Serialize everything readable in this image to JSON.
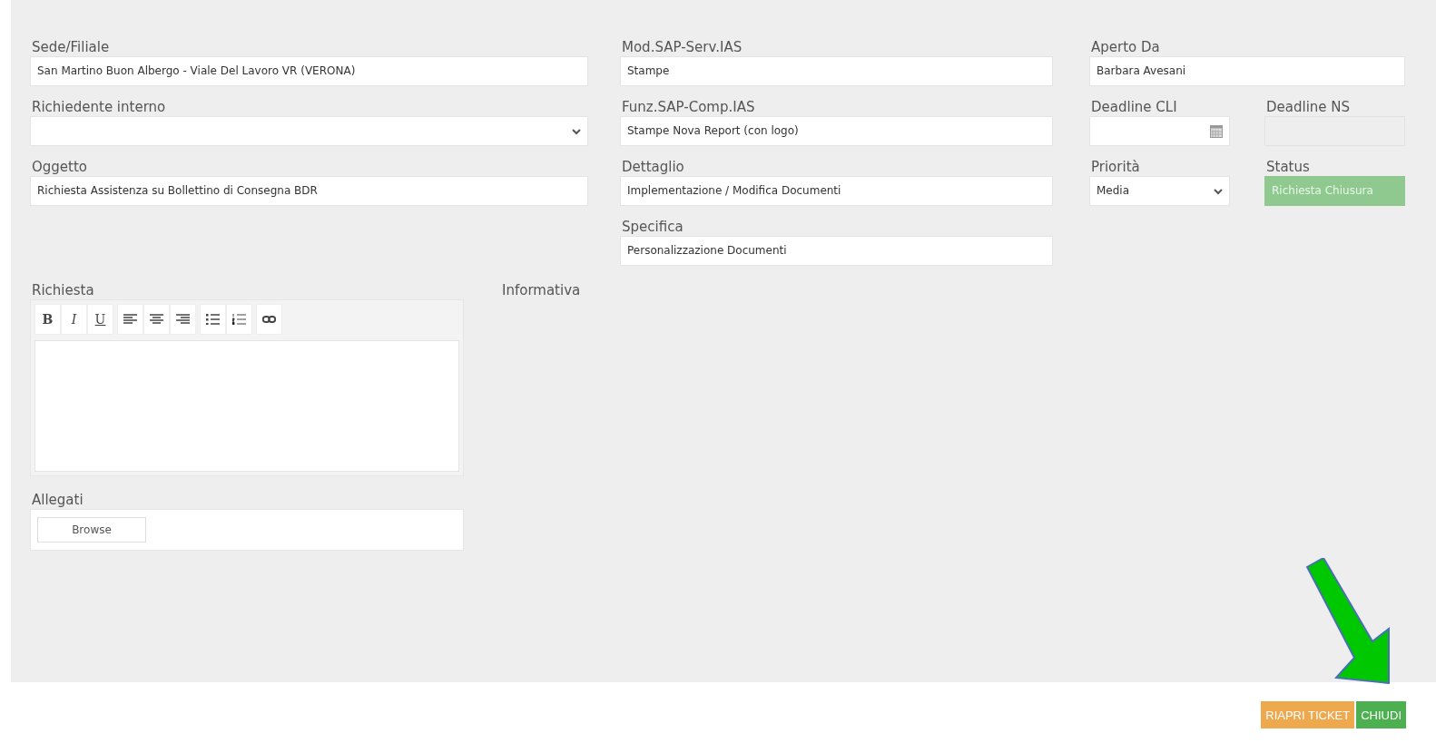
{
  "columns": [
    {
      "kind": "left",
      "rows": [
        [
          {
            "label": "Sede/Filiale",
            "kind": "text",
            "value": "San Martino Buon Albergo - Viale Del Lavoro VR (VERONA)"
          }
        ],
        [
          {
            "label": "Richiedente interno",
            "kind": "select"
          }
        ],
        [
          {
            "label": "Oggetto",
            "kind": "text",
            "value": "Richiesta Assistenza su Bollettino di Consegna BDR"
          }
        ]
      ]
    },
    {
      "kind": "middle",
      "rows": [
        [
          {
            "label": "Mod.SAP-Serv.IAS",
            "kind": "text",
            "value": "Stampe"
          }
        ],
        [
          {
            "label": "Funz.SAP-Comp.IAS",
            "kind": "text",
            "value": "Stampe Nova Report (con logo)"
          }
        ],
        [
          {
            "label": "Dettaglio",
            "kind": "text",
            "value": "Implementazione / Modifica Documenti"
          }
        ],
        [
          {
            "label": "Specifica",
            "kind": "text",
            "value": "Personalizzazione Documenti"
          }
        ]
      ]
    },
    {
      "kind": "right",
      "rows": [
        [
          {
            "label": "Aperto Da",
            "kind": "text",
            "value": "Barbara Avesani"
          }
        ],
        [
          {
            "label": "Deadline CLI",
            "kind": "date"
          },
          {
            "label": "Deadline NS",
            "kind": "readonly"
          }
        ],
        [
          {
            "label": "Priorità",
            "kind": "select",
            "value": "Media"
          },
          {
            "label": "Status",
            "kind": "status",
            "value": "Richiesta Chiusura"
          }
        ]
      ]
    }
  ],
  "richiesta": {
    "label": "Richiesta",
    "toolbar": [
      [
        {
          "kind": "bold",
          "label": "B"
        },
        {
          "kind": "italic",
          "label": "I"
        },
        {
          "kind": "underline",
          "label": "U"
        }
      ],
      [
        {
          "kind": "align-left"
        },
        {
          "kind": "align-center"
        },
        {
          "kind": "align-right"
        }
      ],
      [
        {
          "kind": "bullet-list"
        },
        {
          "kind": "numbered-list"
        }
      ],
      [
        {
          "kind": "link"
        }
      ]
    ]
  },
  "informativa": {
    "label": "Informativa"
  },
  "allegati": {
    "label": "Allegati",
    "button": "Browse"
  },
  "actions": [
    {
      "kind": "warning",
      "label": "RIAPRI TICKET"
    },
    {
      "kind": "success",
      "label": "CHIUDI"
    }
  ]
}
